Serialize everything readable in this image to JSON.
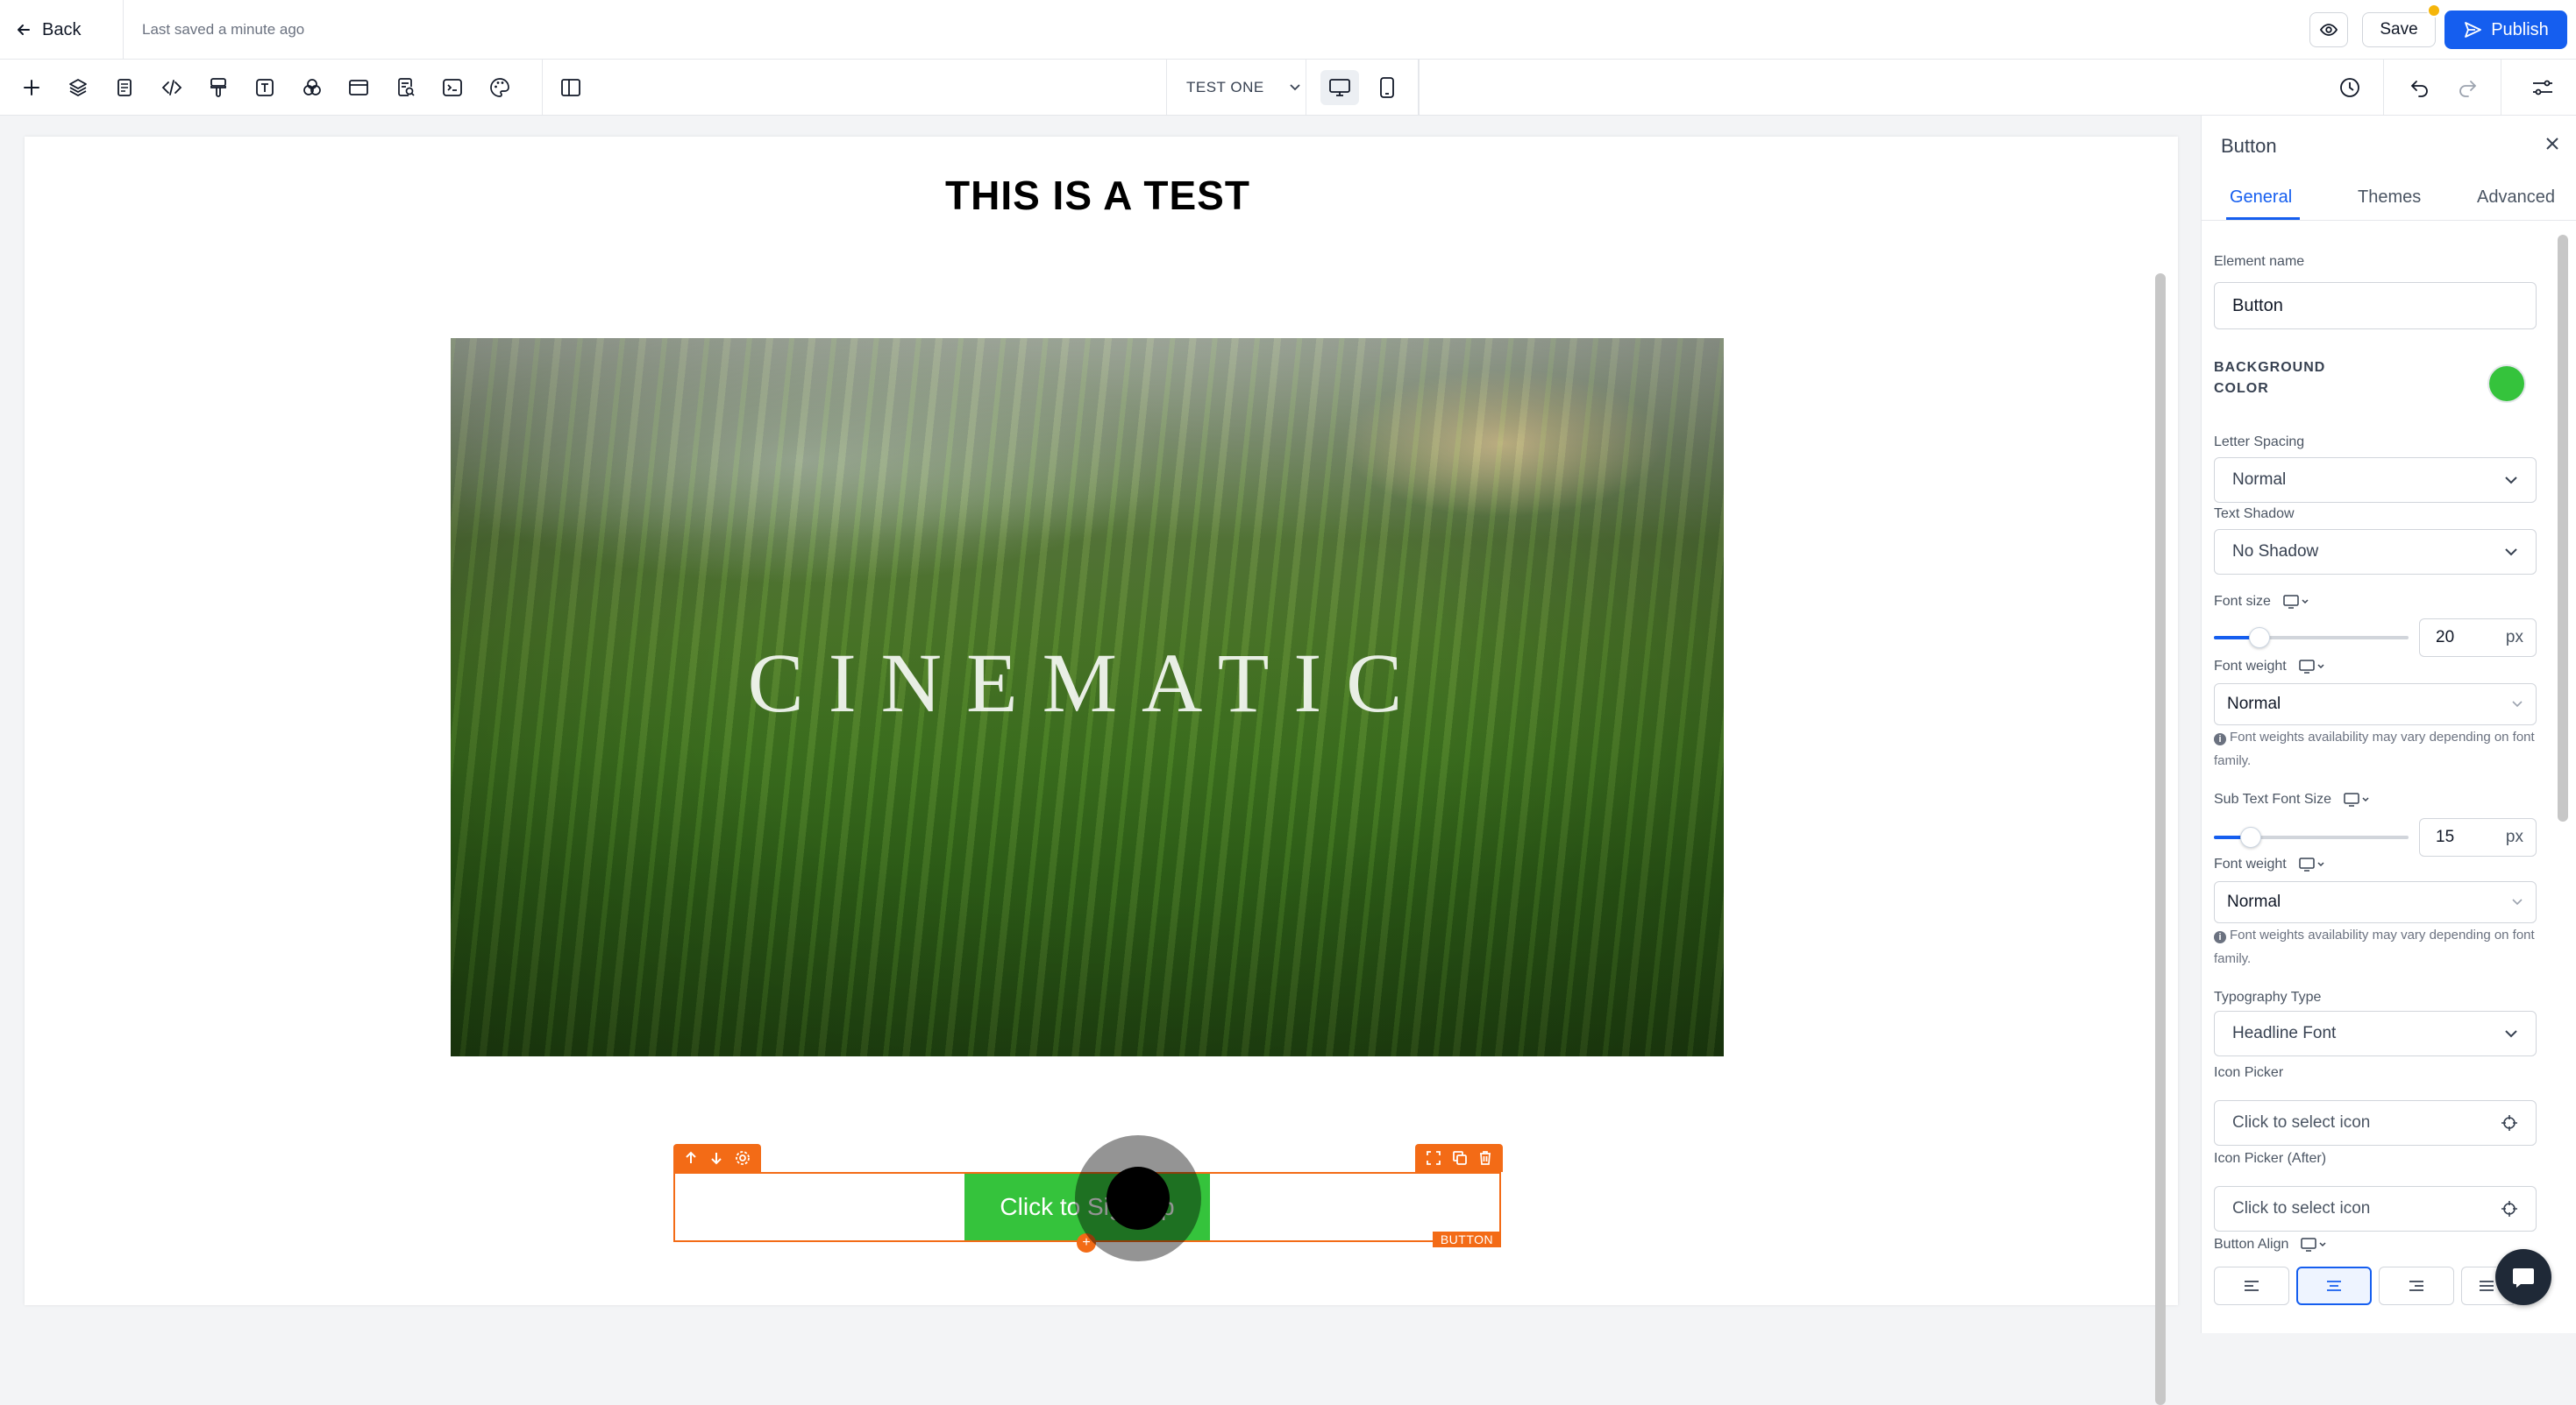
{
  "topbar": {
    "back_label": "Back",
    "saved_status": "Last saved a minute ago",
    "save_label": "Save",
    "publish_label": "Publish"
  },
  "toolbar": {
    "icons": [
      "plus-icon",
      "layers-icon",
      "pages-icon",
      "code-icon",
      "paint-brush-icon",
      "text-icon",
      "colors-icon",
      "section-icon",
      "page-search-icon",
      "terminal-icon",
      "palette-icon",
      "layout-columns-icon"
    ],
    "page_select": "TEST ONE",
    "right_icons": [
      "history-icon",
      "undo-icon",
      "redo-icon",
      "settings-sliders-icon"
    ]
  },
  "canvas": {
    "headline": "THIS IS A TEST",
    "hero_text": "CINEMATIC",
    "button_text": "Click to Sign Up",
    "selection_tag": "BUTTON",
    "button_color": "#35c33c",
    "selection_color": "#f36b16"
  },
  "panel": {
    "title": "Button",
    "tabs": [
      "General",
      "Themes",
      "Advanced"
    ],
    "active_tab": "General",
    "element_name_label": "Element name",
    "element_name_value": "Button",
    "background_color_label_1": "BACKGROUND",
    "background_color_label_2": "COLOR",
    "background_color": "#35c33c",
    "letter_spacing_label": "Letter Spacing",
    "letter_spacing_value": "Normal",
    "text_shadow_label": "Text Shadow",
    "text_shadow_value": "No Shadow",
    "font_size_label": "Font size",
    "font_size_value": "20",
    "font_size_unit": "px",
    "font_weight_label": "Font weight",
    "font_weight_value": "Normal",
    "font_weight_note": "Font weights availability may vary depending on font family.",
    "sub_font_size_label": "Sub Text Font Size",
    "sub_font_size_value": "15",
    "sub_font_size_unit": "px",
    "sub_font_weight_label": "Font weight",
    "sub_font_weight_value": "Normal",
    "sub_font_weight_note": "Font weights availability may vary depending on font family.",
    "typography_label": "Typography Type",
    "typography_value": "Headline Font",
    "icon_picker_label": "Icon Picker",
    "icon_picker_placeholder": "Click to select icon",
    "icon_picker_after_label": "Icon Picker (After)",
    "icon_picker_after_placeholder": "Click to select icon",
    "button_align_label": "Button Align",
    "button_align_options": [
      "left",
      "center",
      "right",
      "justify"
    ],
    "button_align_value": "center"
  }
}
